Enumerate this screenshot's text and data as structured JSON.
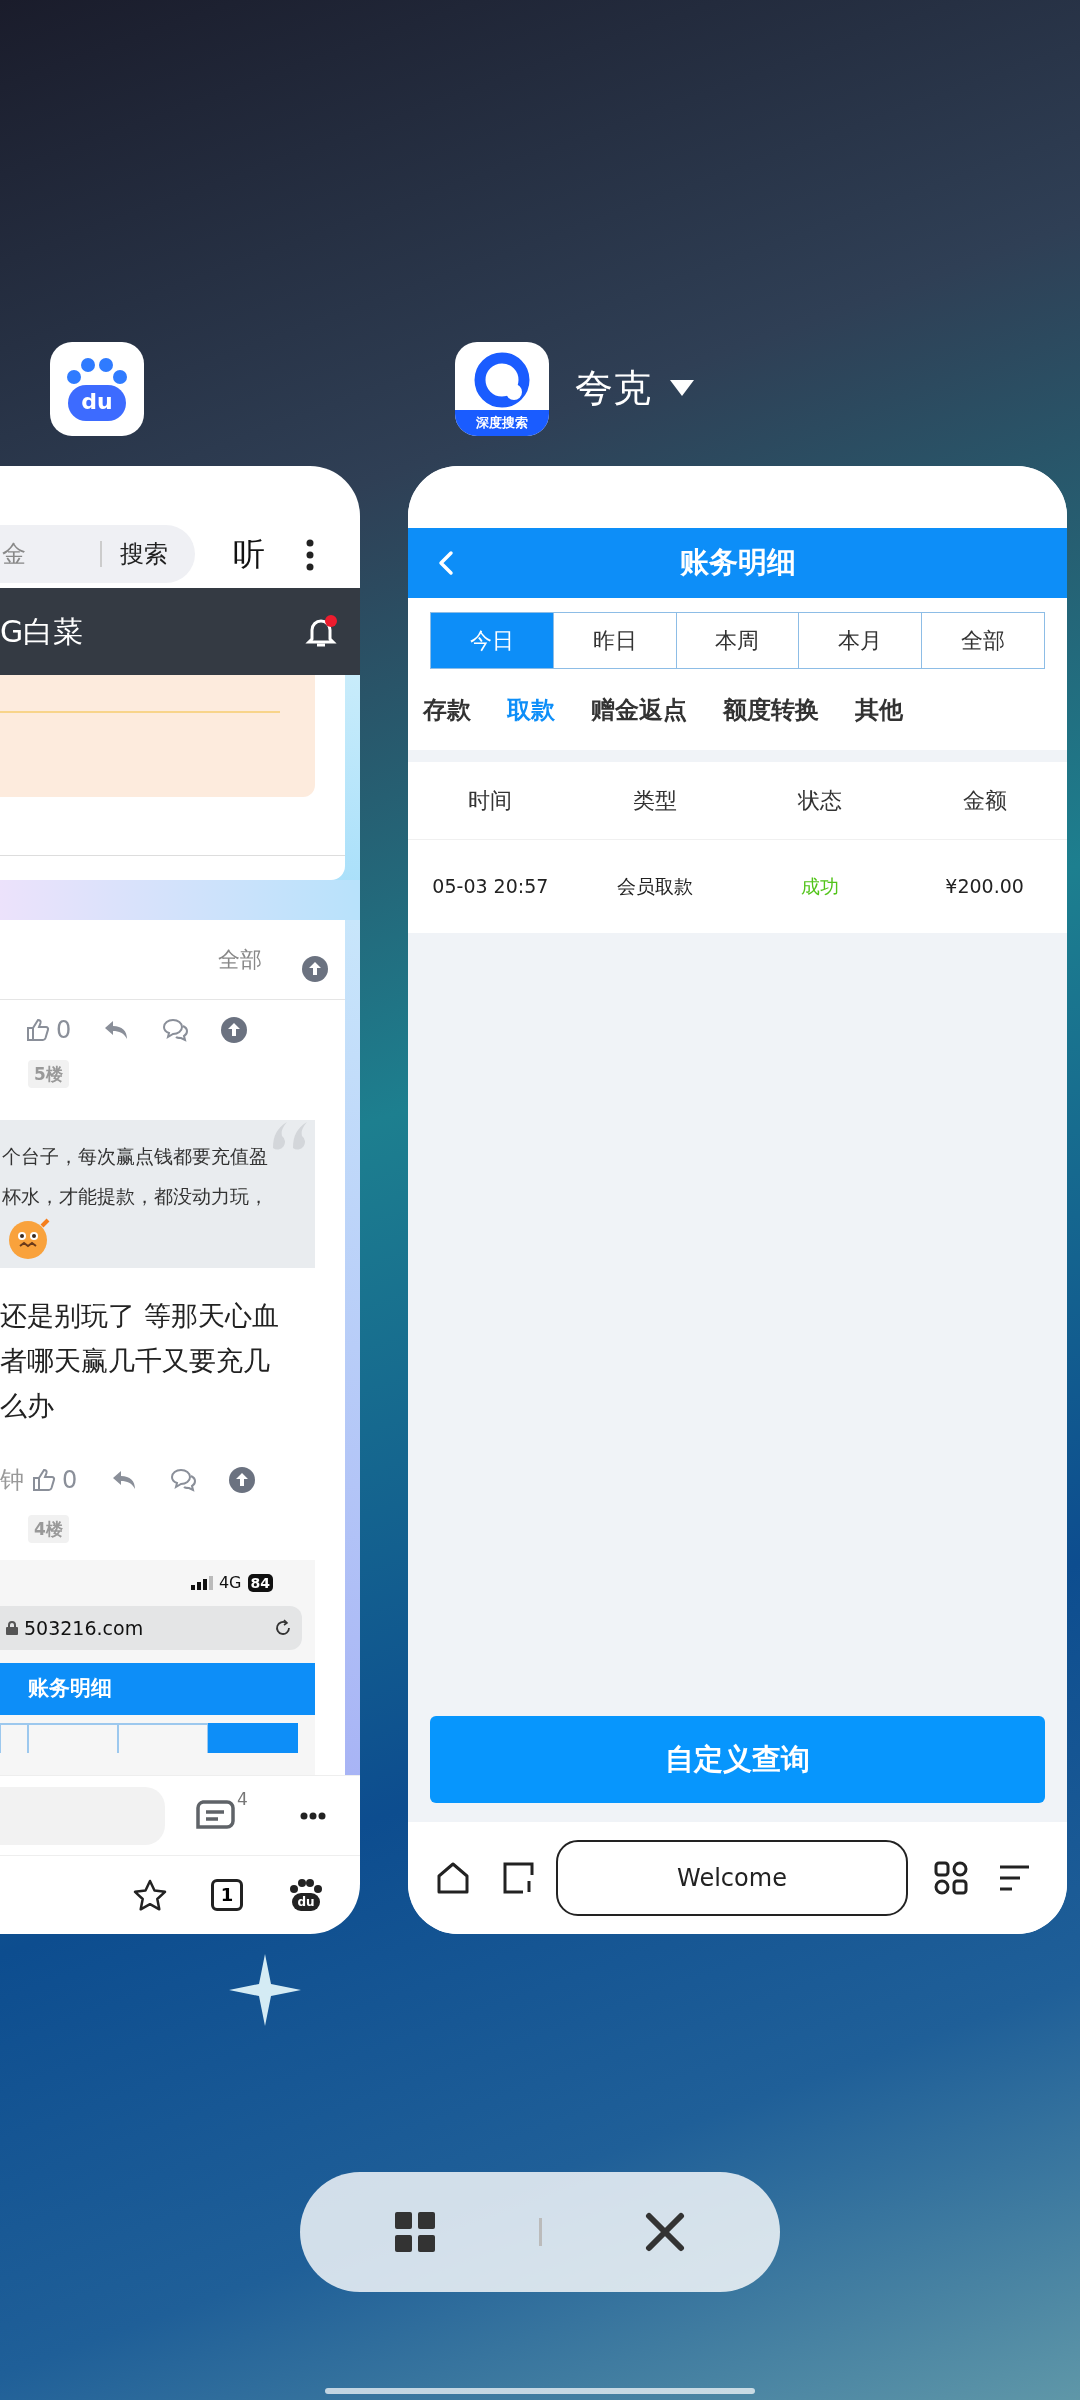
{
  "recent_apps": [
    {
      "kind": "baidu",
      "icon_text": "du"
    },
    {
      "kind": "quark",
      "icon_text": "深度搜索",
      "app_name": "夸克"
    }
  ],
  "baidu_card": {
    "search_placeholder": "金",
    "search_button": "搜索",
    "listen_button": "听",
    "site_title": "G白菜",
    "notification": true,
    "filter": "全部",
    "first_actions": {
      "likes": "0",
      "floor": "5楼"
    },
    "quote_lines": [
      "个台子，每次赢点钱都要充值盈",
      "杯水，才能提款，都没动力玩，"
    ],
    "reply_lines": [
      "还是别玩了 等那天心血",
      "者哪天赢几千又要充几",
      "么办"
    ],
    "second_actions": {
      "time": "钟",
      "likes": "0",
      "floor": "4楼"
    },
    "embedded_screenshot": {
      "network": "4G",
      "battery": "84",
      "url": "503216.com",
      "title": "账务明细"
    },
    "toolbar": {
      "comment_count": "4",
      "tab_count": "1",
      "logo_text": "du"
    }
  },
  "quark_card": {
    "header_title": "账务明细",
    "periods": [
      {
        "label": "今日",
        "selected": true
      },
      {
        "label": "昨日",
        "selected": false
      },
      {
        "label": "本周",
        "selected": false
      },
      {
        "label": "本月",
        "selected": false
      },
      {
        "label": "全部",
        "selected": false
      }
    ],
    "categories": [
      {
        "label": "存款",
        "selected": false
      },
      {
        "label": "取款",
        "selected": true
      },
      {
        "label": "赠金返点",
        "selected": false
      },
      {
        "label": "额度转换",
        "selected": false
      },
      {
        "label": "其他",
        "selected": false
      }
    ],
    "columns": [
      "时间",
      "类型",
      "状态",
      "金额"
    ],
    "rows": [
      {
        "time": "05-03 20:57",
        "type": "会员取款",
        "status": "成功",
        "color": "#52c41a",
        "amount": "¥200.00"
      }
    ],
    "query_button": "自定义查询",
    "address_bar": "Welcome"
  }
}
